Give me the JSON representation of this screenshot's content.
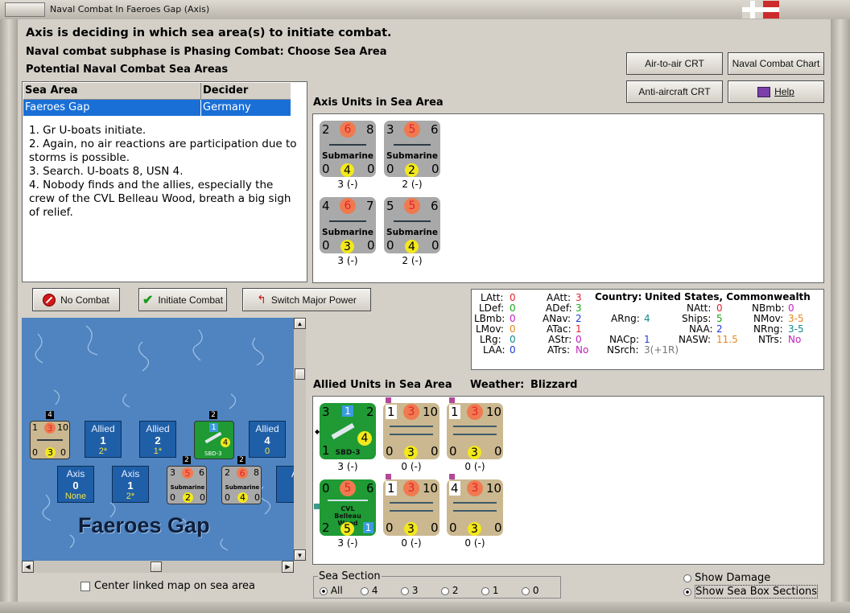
{
  "window": {
    "title": "Naval Combat In Faeroes Gap (Axis)"
  },
  "header": {
    "status": "Axis is deciding in which sea area(s) to initiate combat.",
    "subphase": "Naval combat subphase is Phasing Combat: Choose Sea Area",
    "potential_label": "Potential Naval Combat Sea Areas"
  },
  "buttons": {
    "air_to_air": "Air-to-air CRT",
    "naval_chart": "Naval Combat Chart",
    "anti_aircraft": "Anti-aircraft CRT",
    "help": "Help",
    "no_combat": "No Combat",
    "initiate_combat": "Initiate Combat",
    "switch_power": "Switch Major Power"
  },
  "sea_table": {
    "headers": [
      "Sea Area",
      "Decider"
    ],
    "rows": [
      {
        "sea": "Faeroes Gap",
        "decider": "Germany"
      }
    ]
  },
  "notes": [
    "1. Gr U-boats initiate.",
    "2. Again, no air reactions are participation due to storms is possible.",
    "3. Search. U-boats 8, USN 4.",
    "4. Nobody finds and the allies, especially the crew of the CVL Belleau Wood, breath a big sigh of relief."
  ],
  "axis_units": {
    "label": "Axis Units in Sea Area",
    "units": [
      {
        "tl": "2",
        "tc": "6",
        "tr": "8",
        "name": "Submarine",
        "bl": "0",
        "bc": "4",
        "br": "0",
        "under": "3 (-)"
      },
      {
        "tl": "3",
        "tc": "5",
        "tr": "6",
        "name": "Submarine",
        "bl": "0",
        "bc": "2",
        "br": "0",
        "under": "2 (-)"
      },
      {
        "tl": "4",
        "tc": "6",
        "tr": "7",
        "name": "Submarine",
        "bl": "0",
        "bc": "3",
        "br": "0",
        "under": "3 (-)"
      },
      {
        "tl": "5",
        "tc": "5",
        "tr": "6",
        "name": "Submarine",
        "bl": "0",
        "bc": "4",
        "br": "0",
        "under": "2 (-)"
      }
    ]
  },
  "stats": {
    "latt_l": "LAtt:",
    "latt_v": "0",
    "ldef_l": "LDef:",
    "ldef_v": "0",
    "lbmb_l": "LBmb:",
    "lbmb_v": "0",
    "lmov_l": "LMov:",
    "lmov_v": "0",
    "lrg_l": "LRg:",
    "lrg_v": "0",
    "laa_l": "LAA:",
    "laa_v": "0",
    "aatt_l": "AAtt:",
    "aatt_v": "3",
    "adef_l": "ADef:",
    "adef_v": "3",
    "anav_l": "ANav:",
    "anav_v": "2",
    "atac_l": "ATac:",
    "atac_v": "1",
    "astr_l": "AStr:",
    "astr_v": "0",
    "atrs_l": "ATrs:",
    "atrs_v": "No",
    "country_l": "Country:",
    "country_v": "United States, Commonwealth",
    "arng_l": "ARng:",
    "arng_v": "4",
    "nacp_l": "NACp:",
    "nacp_v": "1",
    "nsrch_l": "NSrch:",
    "nsrch_v": "3(+1R)",
    "natt_l": "NAtt:",
    "natt_v": "0",
    "ships_l": "Ships:",
    "ships_v": "5",
    "naa_l": "NAA:",
    "naa_v": "2",
    "nasw_l": "NASW:",
    "nasw_v": "11.5",
    "nbmb_l": "NBmb:",
    "nbmb_v": "0",
    "nmov_l": "NMov:",
    "nmov_v": "3-5",
    "nrng_l": "NRng:",
    "nrng_v": "3-5",
    "ntrs_l": "NTrs:",
    "ntrs_v": "No"
  },
  "allied": {
    "label": "Allied Units in Sea Area",
    "weather_label": "Weather:",
    "weather_value": "Blizzard",
    "units": [
      {
        "kind": "air",
        "tl": "3",
        "tc": "1",
        "tr": "2",
        "name": "SBD-3",
        "bl": "1",
        "bc": "4",
        "br": "",
        "under": "3 (-)"
      },
      {
        "kind": "ship",
        "tl": "1",
        "tc": "3",
        "tr": "10",
        "name": "",
        "bl": "0",
        "bc": "3",
        "br": "0",
        "under": "0 (-)"
      },
      {
        "kind": "ship",
        "tl": "1",
        "tc": "3",
        "tr": "10",
        "name": "",
        "bl": "0",
        "bc": "3",
        "br": "0",
        "under": "0 (-)"
      },
      {
        "kind": "carrier",
        "tl": "0",
        "tc": "5",
        "tr": "6",
        "name": "CVL Belleau Wood",
        "bl": "2",
        "bc": "5",
        "br": "1",
        "under": "3 (-)"
      },
      {
        "kind": "ship",
        "tl": "1",
        "tc": "3",
        "tr": "10",
        "name": "",
        "bl": "0",
        "bc": "3",
        "br": "0",
        "under": "0 (-)"
      },
      {
        "kind": "ship",
        "tl": "4",
        "tc": "3",
        "tr": "10",
        "name": "",
        "bl": "0",
        "bc": "3",
        "br": "0",
        "under": "0 (-)"
      }
    ]
  },
  "map": {
    "name": "Faeroes Gap",
    "boxes": [
      {
        "side": "Allied",
        "num": "1",
        "val": "2*"
      },
      {
        "side": "Allied",
        "num": "2",
        "val": "1*"
      },
      {
        "side": "Allied",
        "num": "4",
        "val": "0"
      },
      {
        "side": "Axis",
        "num": "0",
        "val": "None"
      },
      {
        "side": "Axis",
        "num": "1",
        "val": "2*"
      },
      {
        "side": "A",
        "num": "",
        "val": ""
      }
    ],
    "counters": {
      "ship_tl": "1",
      "ship_tc": "3",
      "ship_tr": "10",
      "ship_bl": "0",
      "ship_bc": "3",
      "ship_br": "0",
      "air_stack": "2",
      "air_tc": "1",
      "air_bc": "4",
      "air_name": "SBD-3",
      "sub1_stack": "2",
      "sub1_tl": "3",
      "sub1_tc": "5",
      "sub1_tr": "6",
      "sub1_bl": "0",
      "sub1_bc": "2",
      "sub1_br": "0",
      "sub1_name": "Submarine",
      "sub2_stack": "2",
      "sub2_tl": "2",
      "sub2_tc": "6",
      "sub2_tr": "8",
      "sub2_bl": "0",
      "sub2_bc": "4",
      "sub2_br": "0",
      "sub2_name": "Submarine",
      "ship_stack": "4"
    }
  },
  "footer": {
    "center_map": "Center linked map on sea area",
    "sea_section_label": "Sea Section",
    "sea_options": [
      "All",
      "4",
      "3",
      "2",
      "1",
      "0"
    ],
    "show_damage": "Show Damage",
    "show_sections": "Show Sea Box Sections"
  }
}
